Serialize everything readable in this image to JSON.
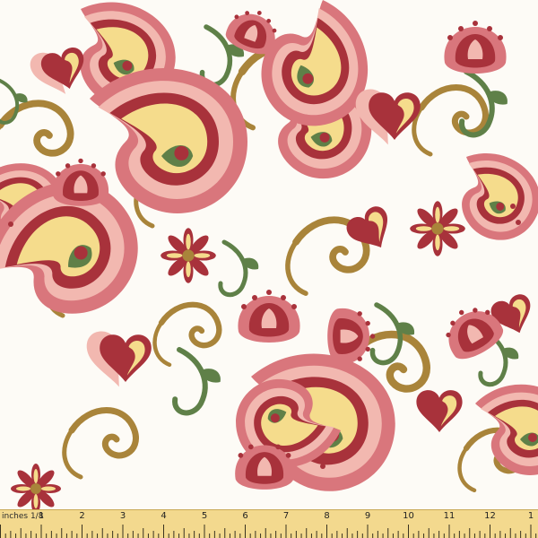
{
  "image": {
    "subject": "paisley-floral-fabric-swatch",
    "palette": {
      "background": "#fdfbf6",
      "crimson": "#a8323b",
      "rose": "#d9767c",
      "blush": "#f2b8b0",
      "cream": "#f5dc8c",
      "gold": "#a9843a",
      "olive": "#5f8048",
      "ruler": "#f3d98e"
    }
  },
  "ruler": {
    "unit_label": "inches 1/8",
    "numbers": [
      "1",
      "2",
      "3",
      "4",
      "5",
      "6",
      "7",
      "8",
      "9",
      "10",
      "11",
      "12",
      "1"
    ]
  }
}
